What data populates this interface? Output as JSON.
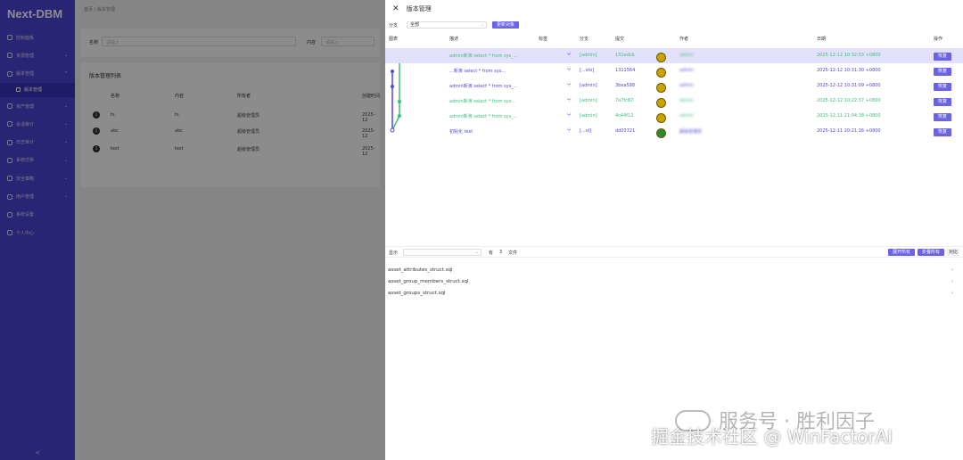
{
  "app": {
    "logo": "Next-DBM"
  },
  "sidebar": {
    "items": [
      {
        "label": "控制面板",
        "arrow": ""
      },
      {
        "label": "资源管理",
        "arrow": "⌄"
      },
      {
        "label": "版本管理",
        "arrow": "^"
      },
      {
        "label": "版本管理",
        "arrow": ""
      },
      {
        "label": "资产管理",
        "arrow": "⌄"
      },
      {
        "label": "会话审计",
        "arrow": "⌄"
      },
      {
        "label": "日志审计",
        "arrow": "⌄"
      },
      {
        "label": "系统迁移",
        "arrow": "⌄"
      },
      {
        "label": "安全策略",
        "arrow": "⌄"
      },
      {
        "label": "用户管理",
        "arrow": "⌄"
      },
      {
        "label": "系统设置",
        "arrow": ""
      },
      {
        "label": "个人中心",
        "arrow": ""
      }
    ],
    "collapse": "<"
  },
  "main": {
    "breadcrumb": "首页 / 版本管理",
    "filter": {
      "name_label": "名称",
      "name_placeholder": "请输入",
      "content_label": "内容",
      "content_placeholder": "请输入"
    },
    "list_title": "版本管理列表",
    "columns": [
      "名称",
      "内容",
      "所有者",
      "创建时间"
    ],
    "rows": [
      {
        "num": "1",
        "name": "ts",
        "content": "ts",
        "owner": "超级管理员",
        "time": "2025-12"
      },
      {
        "num": "2",
        "name": "abc",
        "content": "abc",
        "owner": "超级管理员",
        "time": "2025-12"
      },
      {
        "num": "3",
        "name": "test",
        "content": "test",
        "owner": "超级管理员",
        "time": "2025-12"
      }
    ]
  },
  "drawer": {
    "title": "版本管理",
    "close": "✕",
    "branch_label": "分支",
    "branch_value": "全部",
    "refresh_button": "更新对象",
    "columns": [
      "图表",
      "描述",
      "标签",
      "分支",
      "提交",
      "作者",
      "日期",
      "操作"
    ],
    "commits": [
      {
        "desc": "admin新演 select * from sys_...",
        "branch": "[admin]",
        "hash": "131edcb",
        "author": "admin",
        "date": "2025-12-12 10:32:03 +0800",
        "op": "恢复",
        "color": "#3cbf7a"
      },
      {
        "desc": "...新演 select * from sys...",
        "branch": "[...sto]",
        "hash": "1311564",
        "author": "admin",
        "date": "2025-12-12 10:31:30 +0800",
        "op": "恢复",
        "color": "#5149d8"
      },
      {
        "desc": "admin新演 select * from sys_...",
        "branch": "[admin]",
        "hash": "3bea598",
        "author": "admin",
        "date": "2025-12-12 10:31:09 +0800",
        "op": "恢复",
        "color": "#5149d8"
      },
      {
        "desc": "admin新演 select * from sys...",
        "branch": "[admin]",
        "hash": "7a7fc87",
        "author": "admin",
        "date": "2025-12-12 10:22:37 +0800",
        "op": "恢复",
        "color": "#3cbf7a"
      },
      {
        "desc": "admin新演 select * from sys_...",
        "branch": "[admin]",
        "hash": "4c44f12",
        "author": "admin",
        "date": "2025-12-11 21:04:38 +0800",
        "op": "恢复",
        "color": "#3cbf7a"
      },
      {
        "desc": "初始化 test",
        "branch": "[...ol]",
        "hash": "dd03721",
        "author": "超级管理员",
        "date": "2025-12-11 20:21:16 +0800",
        "op": "恢复",
        "color": "#5149d8"
      }
    ],
    "diff": {
      "label": "显示",
      "count_prefix": "有",
      "count": "3",
      "count_suffix": "文件",
      "buttons": [
        "展开所有",
        "折叠所有",
        "对比"
      ]
    },
    "files": [
      "asset_attributes_struct.sql",
      "asset_group_members_struct.sql",
      "asset_groups_struct.sql"
    ]
  },
  "watermark": {
    "line1": "服务号 · 胜利因子",
    "line2": "掘金技术社区 @ WinFactorAI"
  }
}
